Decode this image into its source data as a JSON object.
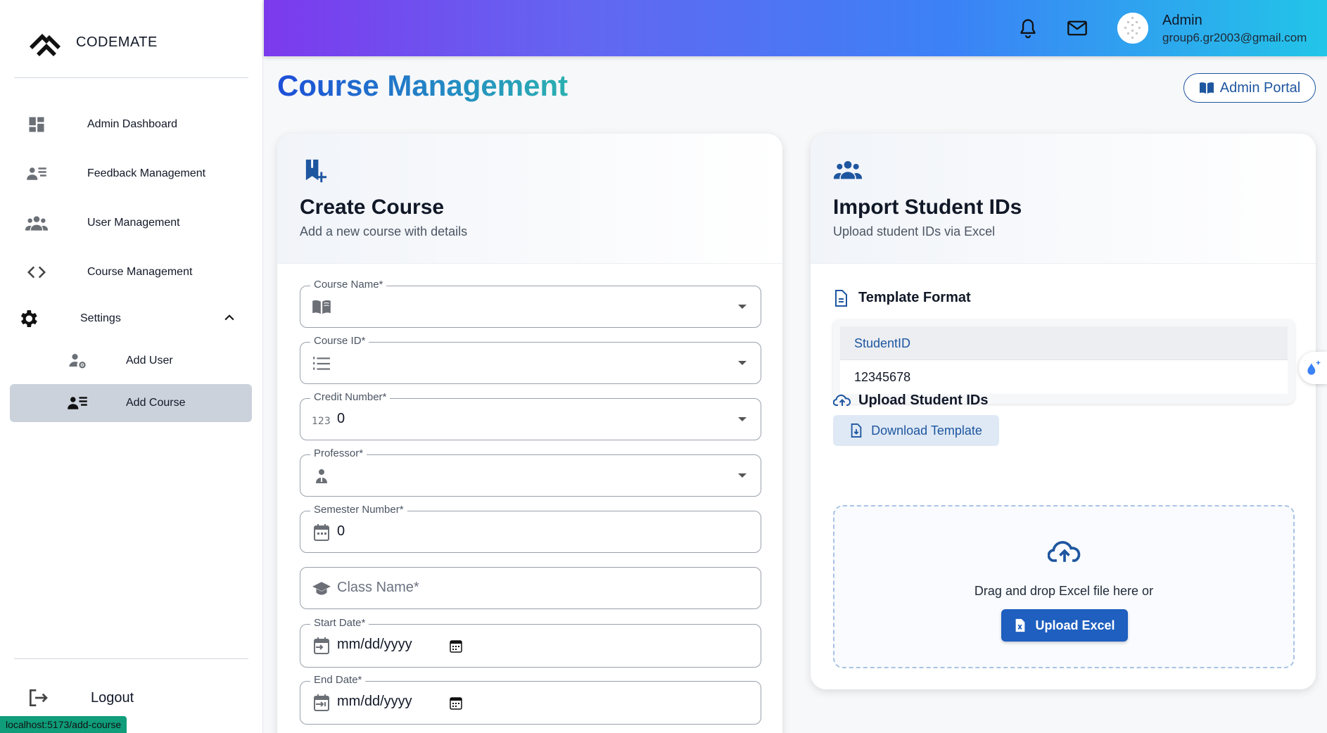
{
  "brand": {
    "name": "CODEMATE"
  },
  "sidebar": {
    "items": [
      {
        "label": "Admin Dashboard",
        "icon": "dashboard-icon"
      },
      {
        "label": "Feedback Management",
        "icon": "feedback-list-icon"
      },
      {
        "label": "User Management",
        "icon": "group-icon"
      },
      {
        "label": "Course Management",
        "icon": "code-icon"
      },
      {
        "label": "Settings",
        "icon": "gear-icon",
        "expanded": true
      }
    ],
    "sub_items": [
      {
        "label": "Add User",
        "icon": "user-settings-icon"
      },
      {
        "label": "Add Course",
        "icon": "feedback-list-icon",
        "active": true
      }
    ],
    "logout_label": "Logout"
  },
  "status_url": "localhost:5173/add-course",
  "topbar": {
    "user_name": "Admin",
    "user_email": "group6.gr2003@gmail.com",
    "icons": [
      "bell-icon",
      "mail-icon",
      "avatar"
    ]
  },
  "page": {
    "title": "Course Management",
    "portal_button": "Admin Portal"
  },
  "create_course": {
    "title": "Create Course",
    "subtitle": "Add a new course with details",
    "fields": {
      "course_name": {
        "label": "Course Name*",
        "value": ""
      },
      "course_id": {
        "label": "Course ID*",
        "value": ""
      },
      "credit_number": {
        "label": "Credit Number*",
        "value": "0"
      },
      "professor": {
        "label": "Professor*",
        "value": ""
      },
      "semester_number": {
        "label": "Semester Number*",
        "value": "0"
      },
      "class_name": {
        "placeholder": "Class Name*"
      },
      "start_date": {
        "label": "Start Date*",
        "value": "mm/dd/yyyy"
      },
      "end_date": {
        "label": "End Date*",
        "value": "mm/dd/yyyy"
      }
    }
  },
  "import_students": {
    "title": "Import Student IDs",
    "subtitle": "Upload student IDs via Excel",
    "template_title": "Template Format",
    "template_header": "StudentID",
    "template_value": "12345678",
    "download_button": "Download Template",
    "upload_title": "Upload Student IDs",
    "dropzone_text": "Drag and drop Excel file here or",
    "upload_button": "Upload Excel"
  },
  "colors": {
    "accent": "#1e56a0",
    "topbar_gradient": [
      "#7c3aed",
      "#3b82f6",
      "#22c5e8"
    ],
    "active_nav": "#cbd2dc"
  }
}
